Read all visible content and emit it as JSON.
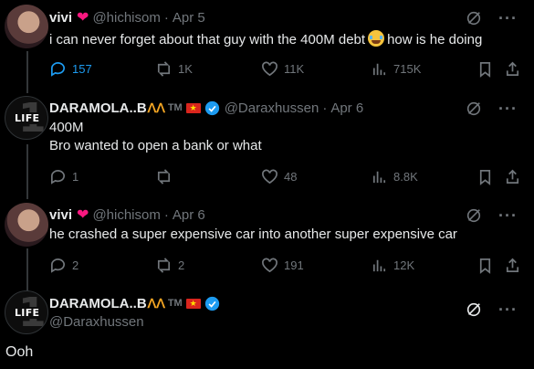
{
  "tweets": [
    {
      "name": "vivi",
      "handle": "@hichisom",
      "date": "Apr 5",
      "text_before": "i can never forget about that guy with the 400M debt",
      "text_after": "how is he doing",
      "replies": "157",
      "reposts": "1K",
      "likes": "11K",
      "views": "715K"
    },
    {
      "name": "DARAMOLA..B",
      "crown": "ᐱᐱ",
      "tm": "TM",
      "handle": "@Daraxhussen",
      "date": "Apr 6",
      "line1": "400M",
      "line2": "Bro wanted to open a bank or what",
      "replies": "1",
      "reposts": "",
      "likes": "48",
      "views": "8.8K"
    },
    {
      "name": "vivi",
      "handle": "@hichisom",
      "date": "Apr 6",
      "text": "he crashed a super expensive car into another super expensive car",
      "replies": "2",
      "reposts": "2",
      "likes": "191",
      "views": "12K"
    }
  ],
  "composer": {
    "name": "DARAMOLA..B",
    "crown": "ᐱᐱ",
    "tm": "TM",
    "handle": "@Daraxhussen",
    "text": "Ooh"
  },
  "avatar_text": {
    "life": "LIFE",
    "one": "1"
  },
  "colors": {
    "accent": "#1d9bf0",
    "muted": "#71767b",
    "heart": "#f91880",
    "background": "#000000"
  },
  "icons": [
    "reply-icon",
    "repost-icon",
    "like-icon",
    "views-icon",
    "bookmark-icon",
    "share-icon",
    "grok-icon",
    "more-icon",
    "verified-icon",
    "heart-emoji-icon",
    "flag-icon",
    "crying-emoji-icon"
  ]
}
